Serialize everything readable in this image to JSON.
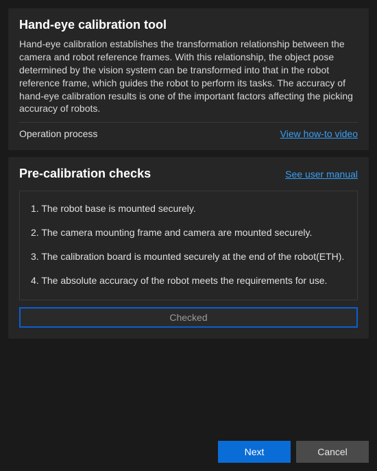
{
  "intro": {
    "title": "Hand-eye calibration tool",
    "description": "Hand-eye calibration establishes the transformation relationship between the camera and robot reference frames. With this relationship, the object pose determined by the vision system can be transformed into that in the robot reference frame, which guides the robot to perform its tasks. The accuracy of hand-eye calibration results is one of the important factors affecting the picking accuracy of robots.",
    "operation_label": "Operation process",
    "video_link": "View how-to video"
  },
  "checks": {
    "title": "Pre-calibration checks",
    "manual_link": "See user manual",
    "items": [
      "1. The robot base is mounted securely.",
      "2. The camera mounting frame and camera are mounted securely.",
      "3. The calibration board is mounted securely at the end of the robot(ETH).",
      "4. The absolute accuracy of the robot meets the requirements for use."
    ],
    "checked_button": "Checked"
  },
  "footer": {
    "next": "Next",
    "cancel": "Cancel"
  }
}
